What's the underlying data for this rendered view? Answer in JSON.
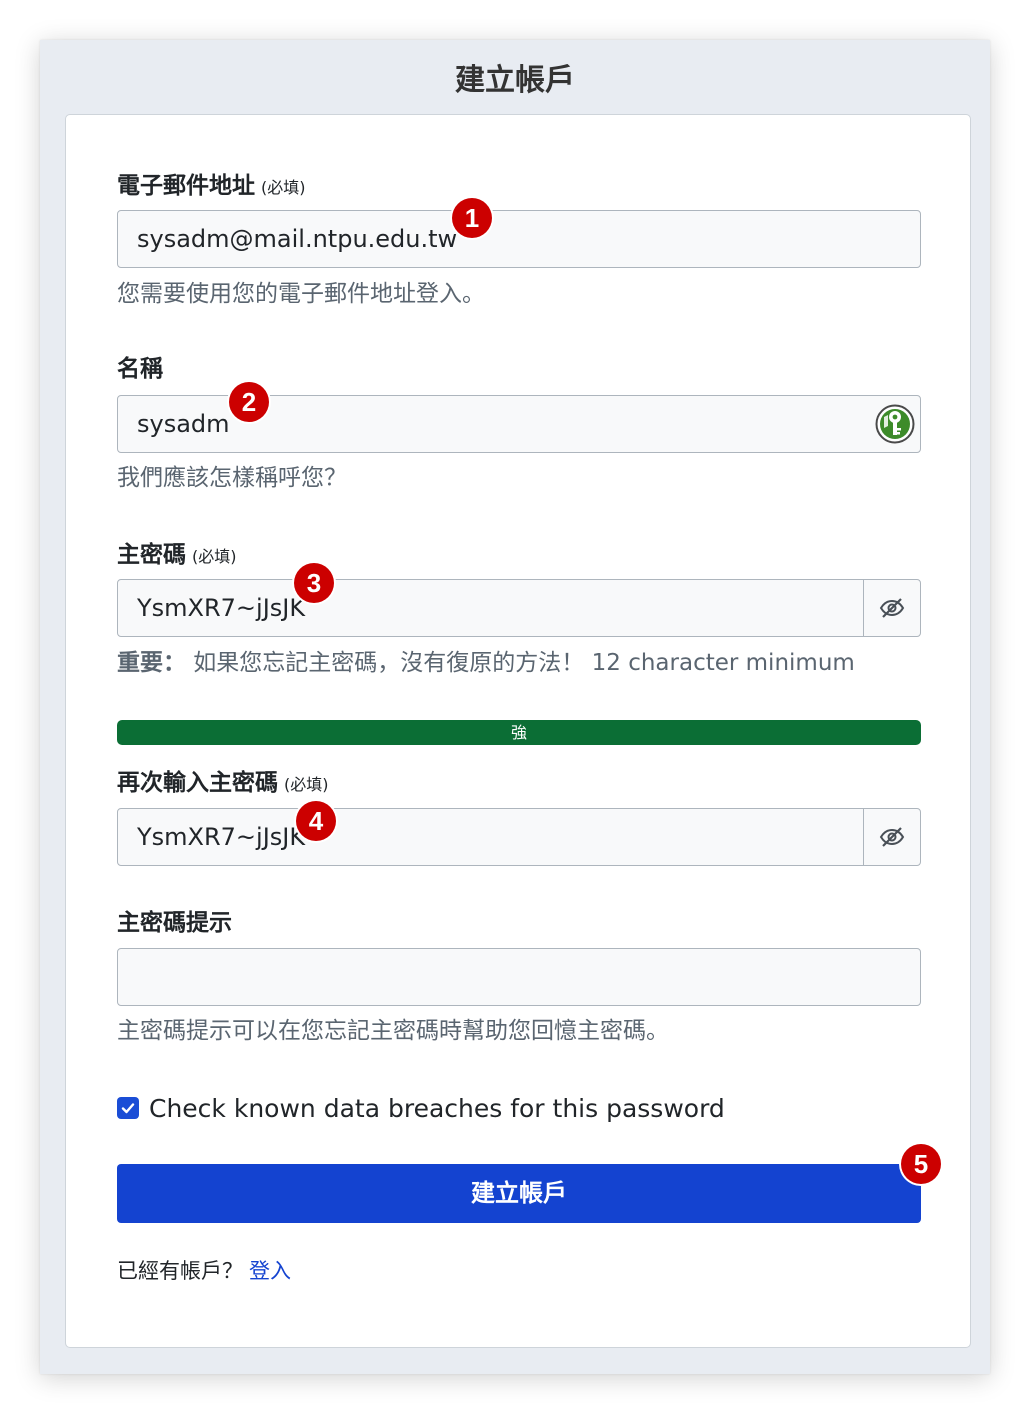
{
  "window": {
    "title": "建立帳戶"
  },
  "email": {
    "label": "電子郵件地址",
    "required": "(必填)",
    "value": "sysadm@mail.ntpu.edu.tw",
    "help": "您需要使用您的電子郵件地址登入。",
    "badge": "1"
  },
  "name": {
    "label": "名稱",
    "value": "sysadm",
    "help": "我們應該怎樣稱呼您？",
    "badge": "2",
    "extension_icon": "keepassxc-icon"
  },
  "master_password": {
    "label": "主密碼",
    "required": "(必填)",
    "value": "YsmXR7~jJsJK",
    "help_strong": "重要：",
    "help": " 如果您忘記主密碼，沒有復原的方法！ 12 character minimum",
    "badge": "3",
    "toggle_icon": "eye-slash-icon"
  },
  "strength": {
    "label": "強",
    "level": 1.0,
    "color": "#0b6e35"
  },
  "retype_password": {
    "label": "再次輸入主密碼",
    "required": "(必填)",
    "value": "YsmXR7~jJsJK",
    "badge": "4",
    "toggle_icon": "eye-slash-icon"
  },
  "hint": {
    "label": "主密碼提示",
    "value": "",
    "help": "主密碼提示可以在您忘記主密碼時幫助您回憶主密碼。"
  },
  "breach_check": {
    "checked": true,
    "label": "Check known data breaches for this password"
  },
  "submit": {
    "label": "建立帳戶",
    "badge": "5",
    "color": "#1443d0"
  },
  "footer": {
    "text": "已經有帳戶？",
    "link": "登入"
  }
}
